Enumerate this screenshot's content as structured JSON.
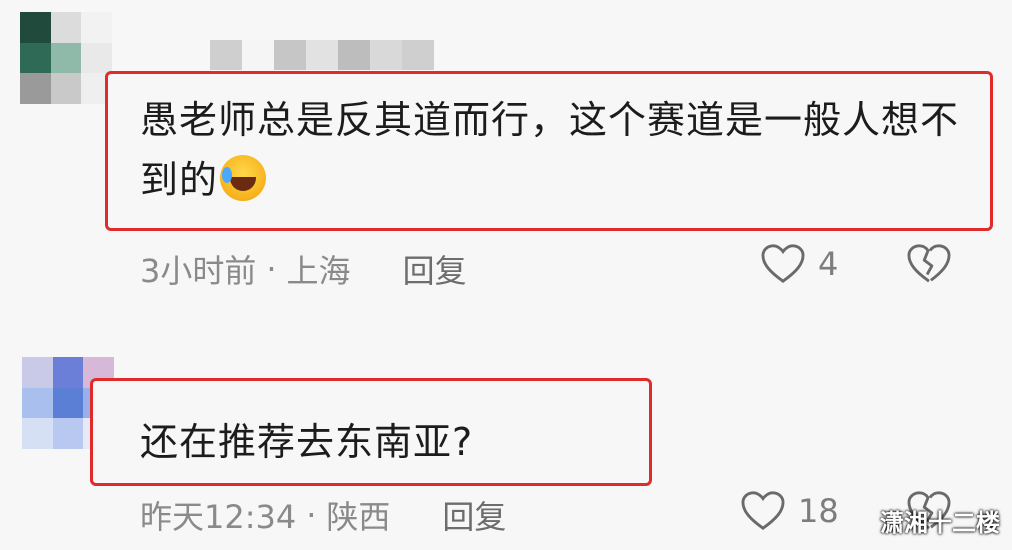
{
  "comments": [
    {
      "text": "愚老师总是反其道而行，这个赛道是一般人想不到的",
      "emoji": "rofl-emoji",
      "time": "3小时前",
      "separator": "·",
      "location": "上海",
      "reply_label": "回复",
      "likes": "4",
      "avatar_colors": [
        "#1f4a3c",
        "#dcdcdc",
        "#f2f2f2",
        "#2e6a56",
        "#8fb9a8",
        "#e9e9e9",
        "#9a9a9a",
        "#c9c9c9",
        "#efefef"
      ],
      "username_colors": [
        "#cfcfcf",
        "#f5f5f5",
        "#c6c6c6",
        "#e2e2e2",
        "#bdbdbd",
        "#d9d9d9",
        "#cfcfcf"
      ]
    },
    {
      "text": "还在推荐去东南亚?",
      "time": "昨天12:34",
      "separator": "·",
      "location": "陕西",
      "reply_label": "回复",
      "likes": "18",
      "avatar_colors": [
        "#c9c9e8",
        "#6b7fd9",
        "#d8b8d8",
        "#a9c0ee",
        "#5c7fd6",
        "#9ab0ea",
        "#d5e0f5",
        "#b8c8f0",
        "#e9e9f6"
      ]
    }
  ],
  "icons": {
    "like": "heart-outline-icon",
    "dislike": "broken-heart-icon"
  },
  "colors": {
    "highlight": "#e12b2b",
    "text": "#1c1c1c",
    "meta": "#8a8a8a"
  },
  "watermark": "潇湘十二楼"
}
